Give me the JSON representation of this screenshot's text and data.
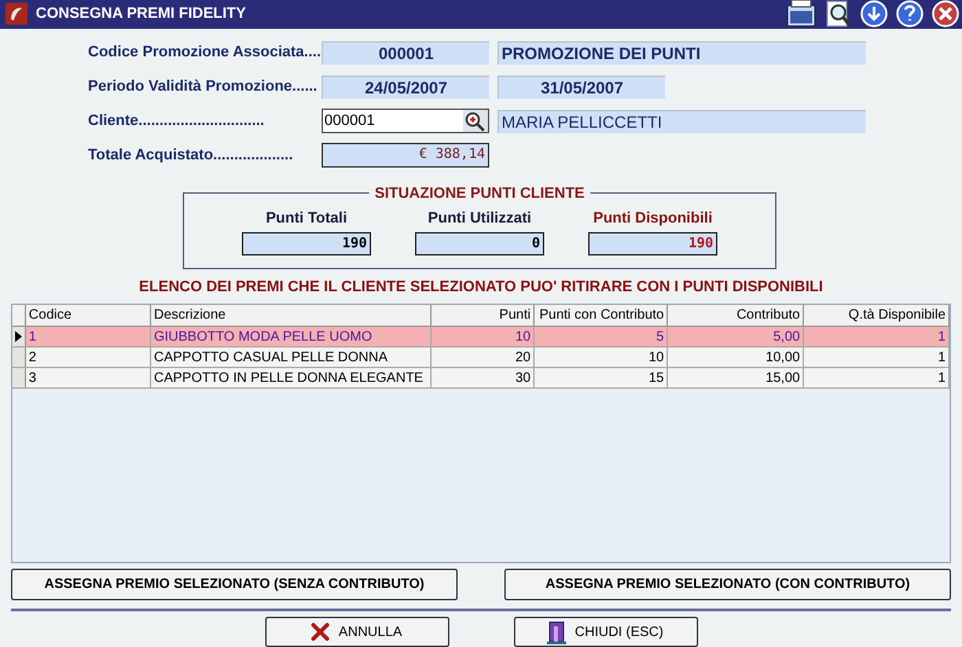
{
  "window": {
    "title": "CONSEGNA PREMI FIDELITY"
  },
  "form": {
    "promo_label": "Codice Promozione Associata....",
    "promo_code": "000001",
    "promo_name": "PROMOZIONE DEI PUNTI",
    "period_label": "Periodo Validità Promozione......",
    "period_from": "24/05/2007",
    "period_to": "31/05/2007",
    "client_label": "Cliente..............................",
    "client_code": "000001",
    "client_name": "MARIA PELLICCETTI",
    "total_label": "Totale Acquistato...................",
    "total_value": "€ 388,14"
  },
  "points": {
    "title": "SITUAZIONE PUNTI CLIENTE",
    "items": [
      {
        "label": "Punti Totali",
        "value": "190",
        "highlight": false
      },
      {
        "label": "Punti Utilizzati",
        "value": "0",
        "highlight": false
      },
      {
        "label": "Punti Disponibili",
        "value": "190",
        "highlight": true
      }
    ]
  },
  "list_title": "ELENCO DEI PREMI CHE IL CLIENTE SELEZIONATO PUO' RITIRARE CON I PUNTI DISPONIBILI",
  "table": {
    "columns": [
      "Codice",
      "Descrizione",
      "Punti",
      "Punti con Contributo",
      "Contributo",
      "Q.tà Disponibile"
    ],
    "rows": [
      {
        "cells": [
          "1",
          "GIUBBOTTO MODA PELLE UOMO",
          "10",
          "5",
          "5,00",
          "1"
        ],
        "selected": true
      },
      {
        "cells": [
          "2",
          "CAPPOTTO CASUAL PELLE DONNA",
          "20",
          "10",
          "10,00",
          "1"
        ],
        "selected": false
      },
      {
        "cells": [
          "3",
          "CAPPOTTO IN PELLE DONNA ELEGANTE",
          "30",
          "15",
          "15,00",
          "1"
        ],
        "selected": false
      }
    ]
  },
  "assign_buttons": [
    "ASSEGNA PREMIO SELEZIONATO (SENZA CONTRIBUTO)",
    "ASSEGNA PREMIO SELEZIONATO (CON CONTRIBUTO)"
  ],
  "footer_buttons": [
    {
      "label": "ANNULLA",
      "kind": "cancel"
    },
    {
      "label": "CHIUDI (ESC)",
      "kind": "close"
    }
  ]
}
